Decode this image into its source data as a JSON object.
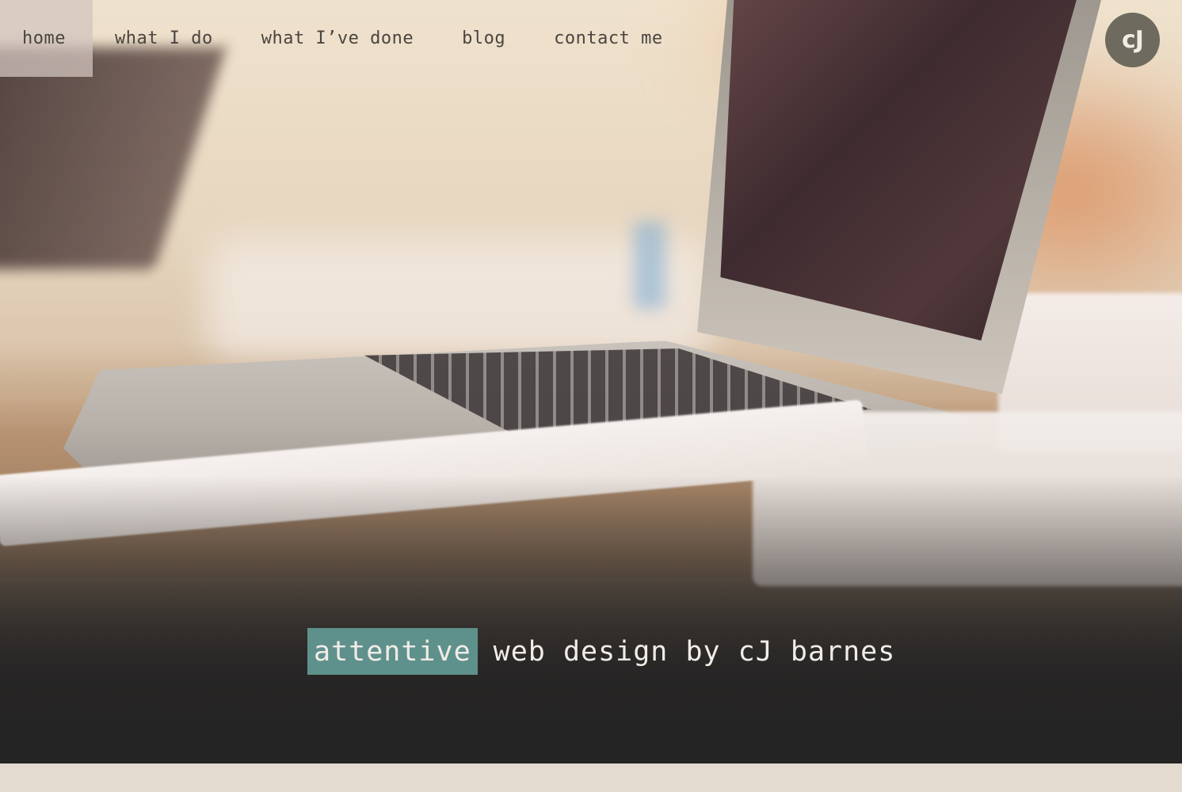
{
  "nav": {
    "items": [
      {
        "label": "home",
        "active": true
      },
      {
        "label": "what I do",
        "active": false
      },
      {
        "label": "what I’ve done",
        "active": false
      },
      {
        "label": "blog",
        "active": false
      },
      {
        "label": "contact me",
        "active": false
      }
    ]
  },
  "logo": {
    "text": "cJ",
    "color": "#6e6a5e"
  },
  "hero": {
    "tagline_highlight": "attentive",
    "tagline_rest": "web design by cJ barnes",
    "highlight_color": "#5f918c"
  },
  "colors": {
    "footer_band": "#e3dbd0",
    "hero_bottom": "#252424"
  }
}
